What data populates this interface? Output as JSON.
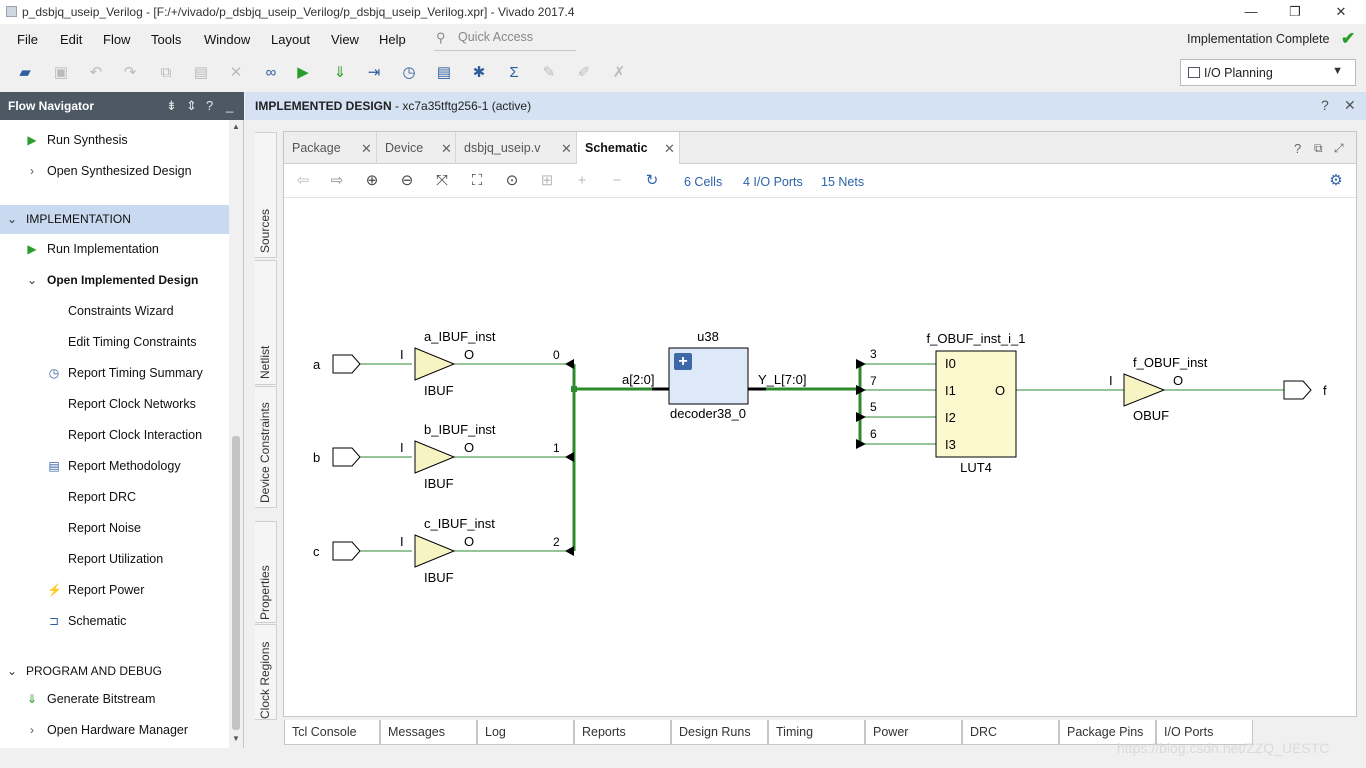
{
  "window": {
    "title": "p_dsbjq_useip_Verilog - [F:/+/vivado/p_dsbjq_useip_Verilog/p_dsbjq_useip_Verilog.xpr] - Vivado 2017.4",
    "minimize": "—",
    "restore": "❐",
    "close": "✕"
  },
  "menu": {
    "items": [
      "File",
      "Edit",
      "Flow",
      "Tools",
      "Window",
      "Layout",
      "View",
      "Help"
    ],
    "quick_access_placeholder": "Quick Access",
    "status": "Implementation Complete",
    "status_color": "#2a9d2a"
  },
  "toolbar": {
    "layout_select": "I/O Planning"
  },
  "flow_navigator": {
    "title": "Flow Navigator",
    "run_synthesis": "Run Synthesis",
    "open_synth": "Open Synthesized Design",
    "impl_section": "IMPLEMENTATION",
    "run_impl": "Run Implementation",
    "open_impl": "Open Implemented Design",
    "items": [
      "Constraints Wizard",
      "Edit Timing Constraints",
      "Report Timing Summary",
      "Report Clock Networks",
      "Report Clock Interaction",
      "Report Methodology",
      "Report DRC",
      "Report Noise",
      "Report Utilization",
      "Report Power",
      "Schematic"
    ],
    "prog_section": "PROGRAM AND DEBUG",
    "gen_bitstream": "Generate Bitstream",
    "open_hw": "Open Hardware Manager"
  },
  "design_header": {
    "name": "IMPLEMENTED DESIGN",
    "part": " - xc7a35tftg256-1",
    "state": "(active)"
  },
  "side_tabs": [
    "Sources",
    "Netlist",
    "Device Constraints",
    "Properties",
    "Clock Regions"
  ],
  "doc_tabs": [
    {
      "label": "Package",
      "active": false
    },
    {
      "label": "Device",
      "active": false
    },
    {
      "label": "dsbjq_useip.v",
      "active": false
    },
    {
      "label": "Schematic",
      "active": true
    }
  ],
  "schematic_toolbar": {
    "cells": "6 Cells",
    "ports": "4 I/O Ports",
    "nets": "15 Nets"
  },
  "schematic": {
    "inputs": [
      "a",
      "b",
      "c"
    ],
    "output": "f",
    "ibufs": [
      {
        "inst": "a_IBUF_inst",
        "type": "IBUF",
        "in": "I",
        "out": "O",
        "bit": "0"
      },
      {
        "inst": "b_IBUF_inst",
        "type": "IBUF",
        "in": "I",
        "out": "O",
        "bit": "1"
      },
      {
        "inst": "c_IBUF_inst",
        "type": "IBUF",
        "in": "I",
        "out": "O",
        "bit": "2"
      }
    ],
    "decoder": {
      "inst": "u38",
      "type": "decoder38_0",
      "in_bus": "a[2:0]",
      "out_bus": "Y_L[7:0]",
      "expand": "+"
    },
    "lut": {
      "inst": "f_OBUF_inst_i_1",
      "type": "LUT4",
      "inputs": [
        "I0",
        "I1",
        "I2",
        "I3"
      ],
      "output": "O",
      "bits": [
        "3",
        "7",
        "5",
        "6"
      ]
    },
    "obuf": {
      "inst": "f_OBUF_inst",
      "type": "OBUF",
      "in": "I",
      "out": "O"
    },
    "wire_color": "#2d8a2d",
    "buffer_fill": "#f7f4c3",
    "lut_fill": "#fdf9cf",
    "decoder_fill": "#dde9f8"
  },
  "bottom_tabs": [
    "Tcl Console",
    "Messages",
    "Log",
    "Reports",
    "Design Runs",
    "Timing",
    "Power",
    "DRC",
    "Package Pins",
    "I/O Ports"
  ],
  "watermark": "https://blog.csdn.net/ZZQ_UESTC"
}
